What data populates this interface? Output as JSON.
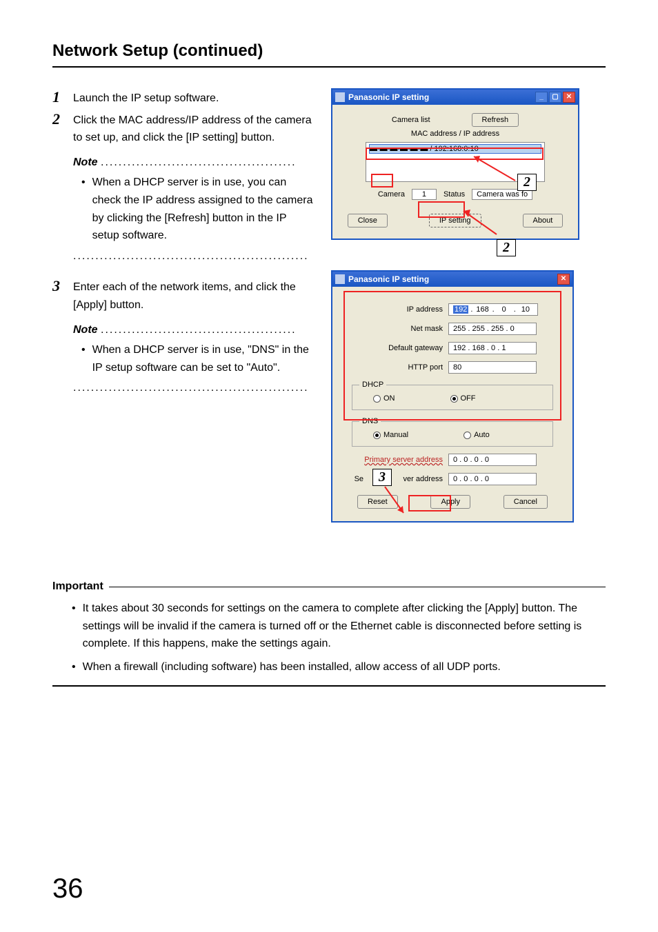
{
  "page": {
    "title": "Network Setup (continued)",
    "number": "36"
  },
  "steps": {
    "s1": {
      "num": "1",
      "text": "Launch the IP setup software."
    },
    "s2": {
      "num": "2",
      "text": "Click the MAC address/IP address of the camera to set up, and click the [IP setting] button."
    },
    "s2_note_label": "Note",
    "s2_note_dots": "............................................",
    "s2_note_bullet": "When a DHCP server is in use, you can check the IP address assigned to the camera by clicking the [Refresh] button in the IP setup software.",
    "s2_end_dots": ".....................................................",
    "s3": {
      "num": "3",
      "text": "Enter each of the network items, and click the [Apply] button."
    },
    "s3_note_label": "Note",
    "s3_note_dots": "............................................",
    "s3_note_bullet": "When a DHCP server is in use, \"DNS\" in the IP setup software can be set to \"Auto\".",
    "s3_end_dots": "....................................................."
  },
  "win1": {
    "title": "Panasonic IP setting",
    "camera_list_label": "Camera list",
    "refresh": "Refresh",
    "mac_ip_label": "MAC address / IP address",
    "list_entry": "▬-▬-▬-▬-▬-▬ / 192:168:0:10",
    "camera_label": "Camera",
    "camera_value": "1",
    "status_label": "Status",
    "status_value": "Camera was fo",
    "close": "Close",
    "ipsetting": "IP setting",
    "about": "About",
    "callout2a": "2",
    "callout2b": "2"
  },
  "win2": {
    "title": "Panasonic IP setting",
    "ip_address_label": "IP address",
    "ip_address_value": {
      "a": "192",
      "b": "168",
      "c": "0",
      "d": "10"
    },
    "netmask_label": "Net mask",
    "netmask_value": "255 . 255 . 255 . 0",
    "gateway_label": "Default gateway",
    "gateway_value": "192 . 168 . 0 . 1",
    "http_label": "HTTP port",
    "http_value": "80",
    "dhcp_legend": "DHCP",
    "dhcp_on": "ON",
    "dhcp_off": "OFF",
    "dns_legend": "DNS",
    "dns_manual": "Manual",
    "dns_auto": "Auto",
    "primary_label": "Primary server address",
    "primary_value": "0 . 0 . 0 . 0",
    "secondary_label_prefix": "Se",
    "secondary_label_suffix": "ver address",
    "secondary_value": "0 . 0 . 0 . 0",
    "reset": "Reset",
    "apply": "Apply",
    "cancel": "Cancel",
    "callout3": "3"
  },
  "important": {
    "heading": "Important",
    "b1": "It takes about 30 seconds for settings on the camera to complete after clicking the [Apply] button. The settings will be invalid if the camera is turned off or the Ethernet cable is disconnected before setting is complete. If this happens, make the settings again.",
    "b2": "When a firewall (including software) has been installed, allow access of all UDP ports."
  }
}
